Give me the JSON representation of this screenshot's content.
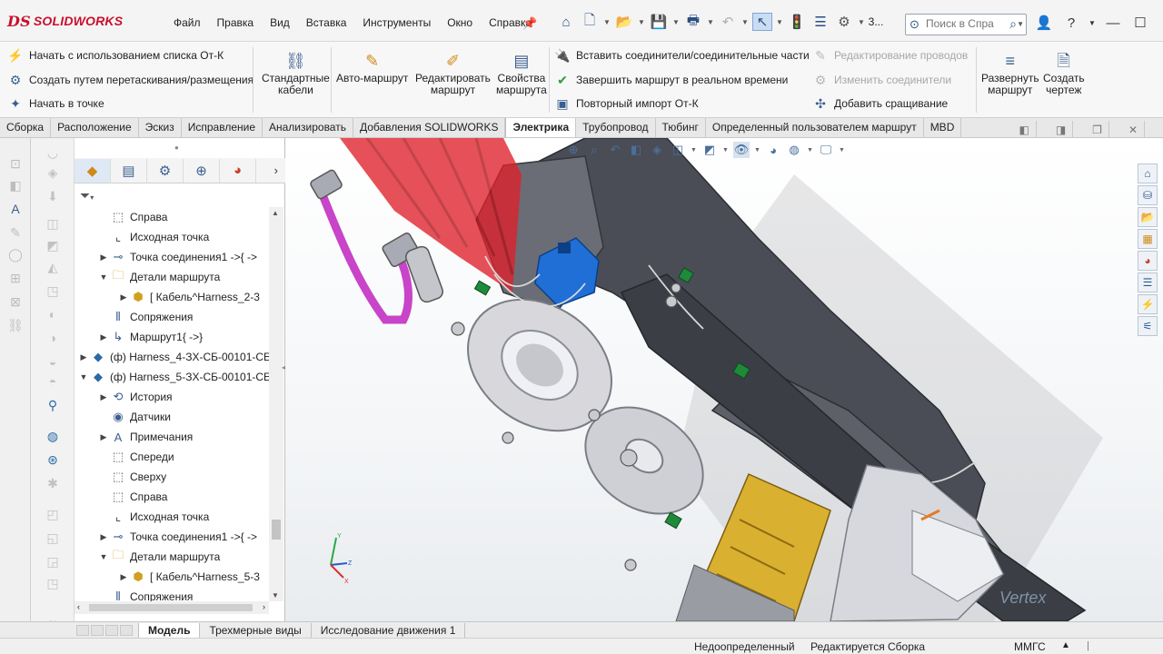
{
  "app": {
    "brand_ds": "DS",
    "brand_name": "SOLIDWORKS"
  },
  "menu": [
    "Файл",
    "Правка",
    "Вид",
    "Вставка",
    "Инструменты",
    "Окно",
    "Справка"
  ],
  "search": {
    "placeholder": "Поиск в Спра"
  },
  "quick_extra": "3...",
  "ribbon": {
    "route_start_list": "Начать с использованием списка От-К",
    "route_drag_drop": "Создать путем перетаскивания/размещения",
    "route_start_point": "Начать в точке",
    "std_cables": [
      "Стандартные",
      "кабели"
    ],
    "auto_route": [
      "Авто-маршрут"
    ],
    "edit_route": [
      "Редактировать",
      "маршрут"
    ],
    "route_props": [
      "Свойства",
      "маршрута"
    ],
    "insert_connectors": "Вставить соединители/соединительные части",
    "finish_route": "Завершить маршрут в реальном времени",
    "reimport": "Повторный импорт От-К",
    "edit_wires": "Редактирование проводов",
    "change_connectors": "Изменить соединители",
    "add_splice": "Добавить сращивание",
    "flatten_route": [
      "Развернуть",
      "маршрут"
    ],
    "create_drawing": [
      "Создать",
      "чертеж"
    ]
  },
  "tabs": [
    "Сборка",
    "Расположение",
    "Эскиз",
    "Исправление",
    "Анализировать",
    "Добавления SOLIDWORKS",
    "Электрика",
    "Трубопровод",
    "Тюбинг",
    "Определенный пользователем маршрут",
    "MBD"
  ],
  "active_tab": "Электрика",
  "tree": {
    "rows": [
      {
        "label": "Справа",
        "icon": "plane-icon",
        "level": 2
      },
      {
        "label": "Исходная точка",
        "icon": "origin-icon",
        "level": 2
      },
      {
        "label": "Точка соединения1 ->{ ->",
        "icon": "connection-point-icon",
        "level": 2,
        "expand": "▶"
      },
      {
        "label": "Детали маршрута",
        "icon": "folder-icon",
        "level": 2,
        "expand": "▼"
      },
      {
        "label": "[ Кабель^Harness_2-3",
        "icon": "cable-part-icon",
        "level": 3,
        "expand": "▶"
      },
      {
        "label": "Сопряжения",
        "icon": "mates-icon",
        "level": 2
      },
      {
        "label": "Маршрут1{ ->}",
        "icon": "route-icon",
        "level": 2,
        "expand": "▶"
      },
      {
        "label": "(ф) Harness_4-ЗХ-СБ-00101-СЕ",
        "icon": "subassembly-icon",
        "level": 1,
        "expand": "▶"
      },
      {
        "label": "(ф) Harness_5-ЗХ-СБ-00101-СЕ",
        "icon": "subassembly-icon",
        "level": 1,
        "expand": "▼"
      },
      {
        "label": "История",
        "icon": "history-icon",
        "level": 2,
        "expand": "▶"
      },
      {
        "label": "Датчики",
        "icon": "sensors-icon",
        "level": 2
      },
      {
        "label": "Примечания",
        "icon": "annotations-icon",
        "level": 2,
        "expand": "▶"
      },
      {
        "label": "Спереди",
        "icon": "plane-icon",
        "level": 2
      },
      {
        "label": "Сверху",
        "icon": "plane-icon",
        "level": 2
      },
      {
        "label": "Справа",
        "icon": "plane-icon",
        "level": 2
      },
      {
        "label": "Исходная точка",
        "icon": "origin-icon",
        "level": 2
      },
      {
        "label": "Точка соединения1 ->{ ->",
        "icon": "connection-point-icon",
        "level": 2,
        "expand": "▶"
      },
      {
        "label": "Детали маршрута",
        "icon": "folder-icon",
        "level": 2,
        "expand": "▼"
      },
      {
        "label": "[ Кабель^Harness_5-3",
        "icon": "cable-part-icon",
        "level": 3,
        "expand": "▶"
      },
      {
        "label": "Сопряжения",
        "icon": "mates-icon",
        "level": 2
      }
    ]
  },
  "triad": {
    "x": "X",
    "y": "Y",
    "z": "Z"
  },
  "watermark": "Vertex",
  "bottom_tabs": [
    "Модель",
    "Трехмерные виды",
    "Исследование движения 1"
  ],
  "status": {
    "definition": "Недоопределенный",
    "editing": "Редактируется Сборка",
    "units": "ММГС"
  },
  "colors": {
    "brand_red": "#c8102e",
    "accent_blue": "#2a5a92",
    "harness_red": "#e0202a",
    "connector_blue": "#1f6fd6",
    "wire_purple": "#c844c8"
  }
}
